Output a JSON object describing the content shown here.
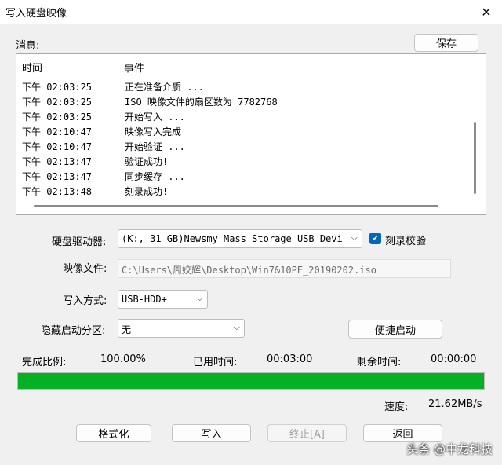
{
  "window": {
    "title": "写入硬盘映像",
    "close_glyph": "✕"
  },
  "messages": {
    "label": "消息:",
    "save_button": "保存",
    "columns": {
      "time": "时间",
      "event": "事件"
    },
    "rows": [
      {
        "time": "下午 02:03:25",
        "event": "正在准备介质 ..."
      },
      {
        "time": "下午 02:03:25",
        "event": "ISO 映像文件的扇区数为 7782768"
      },
      {
        "time": "下午 02:03:25",
        "event": "开始写入 ..."
      },
      {
        "time": "下午 02:10:47",
        "event": "映像写入完成"
      },
      {
        "time": "下午 02:10:47",
        "event": "开始验证 ..."
      },
      {
        "time": "下午 02:13:47",
        "event": "验证成功!"
      },
      {
        "time": "下午 02:13:47",
        "event": "同步缓存 ..."
      },
      {
        "time": "下午 02:13:48",
        "event": "刻录成功!"
      }
    ]
  },
  "form": {
    "drive_label": "硬盘驱动器:",
    "drive_value": "(K:, 31 GB)Newsmy Mass Storage USB Devi",
    "verify_label": "刻录校验",
    "verify_checked": true,
    "image_label": "映像文件:",
    "image_value": "C:\\Users\\周姣辉\\Desktop\\Win7&10PE_20190202.iso",
    "write_mode_label": "写入方式:",
    "write_mode_value": "USB-HDD+",
    "hidden_partition_label": "隐藏启动分区:",
    "hidden_partition_value": "无",
    "quick_boot_button": "便捷启动"
  },
  "status": {
    "ratio_label": "完成比例:",
    "ratio_value": "100.00%",
    "progress_fraction": 1.0,
    "elapsed_label": "已用时间:",
    "elapsed_value": "00:03:00",
    "remaining_label": "剩余时间:",
    "remaining_value": "00:00:00",
    "speed_label": "速度:",
    "speed_value": "21.62MB/s"
  },
  "actions": {
    "format": "格式化",
    "write": "写入",
    "stop": "终止[A]",
    "back": "返回"
  },
  "watermark": "头条 @中龙科技",
  "colors": {
    "accent": "#0067c0",
    "progress": "#06b025"
  }
}
